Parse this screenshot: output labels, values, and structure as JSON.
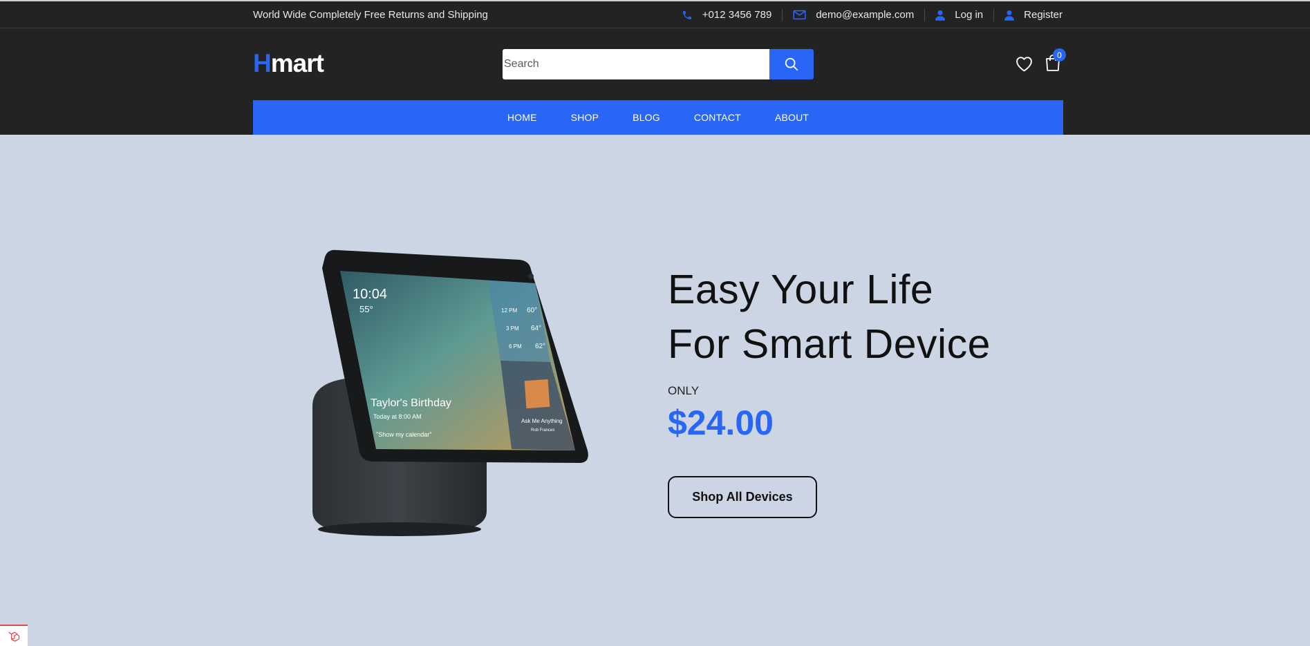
{
  "topbar": {
    "promo": "World Wide Completely Free Returns and Shipping",
    "phone": "+012 3456 789",
    "email": "demo@example.com",
    "login": "Log in",
    "register": "Register"
  },
  "header": {
    "logo_first": "H",
    "logo_rest": "mart",
    "search_placeholder": "Search",
    "cart_count": "0"
  },
  "nav": [
    "HOME",
    "SHOP",
    "BLOG",
    "CONTACT",
    "ABOUT"
  ],
  "hero": {
    "line1": "Easy Your Life",
    "line2": "For Smart Device",
    "only": "ONLY",
    "price": "$24.00",
    "cta": "Shop All Devices",
    "screen": {
      "time": "10:04",
      "temp": "55°",
      "forecast": [
        {
          "time": "12 PM",
          "temp": "60°"
        },
        {
          "time": "3 PM",
          "temp": "64°"
        },
        {
          "time": "6 PM",
          "temp": "62°"
        }
      ],
      "event": "Taylor's Birthday",
      "event_time": "Today at 8:00 AM",
      "prompt": "\"Show my calendar\"",
      "ask": "Ask Me Anything",
      "ask_sub": "Rob Frances"
    }
  },
  "icons": {
    "phone": "phone-icon",
    "email": "envelope-icon",
    "user": "user-icon",
    "search": "search-icon",
    "wishlist": "heart-icon",
    "cart": "shopping-bag-icon"
  },
  "colors": {
    "accent": "#2a66f5",
    "dark": "#232323",
    "hero_bg": "#cbd5e3"
  }
}
